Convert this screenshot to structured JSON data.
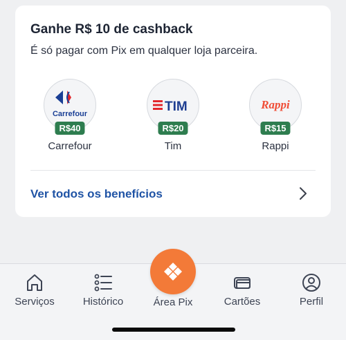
{
  "cashback": {
    "title": "Ganhe R$ 10 de cashback",
    "subtitle": "É só pagar com Pix em qualquer loja parceira.",
    "partners": [
      {
        "name": "Carrefour",
        "badge": "R$40",
        "logo_text": "Carrefour",
        "logo_color": "#1a3f95",
        "icon": "carrefour-logo-icon"
      },
      {
        "name": "Tim",
        "badge": "R$20",
        "logo_text": "TIM",
        "logo_color": "#1e3e91",
        "accent": "#e3262b",
        "icon": "tim-logo-icon"
      },
      {
        "name": "Rappi",
        "badge": "R$15",
        "logo_text": "Rappi",
        "logo_color": "#f04e37",
        "icon": "rappi-logo-icon"
      }
    ],
    "link_label": "Ver todos os benefícios",
    "badge_color": "#2e7d4f"
  },
  "tabbar": {
    "items": [
      {
        "label": "Serviços",
        "icon": "house-icon"
      },
      {
        "label": "Histórico",
        "icon": "list-icon"
      },
      {
        "label": "Área Pix",
        "icon": "pix-icon"
      },
      {
        "label": "Cartões",
        "icon": "cards-icon"
      },
      {
        "label": "Perfil",
        "icon": "profile-icon"
      }
    ],
    "pix_color": "#f37a38"
  }
}
